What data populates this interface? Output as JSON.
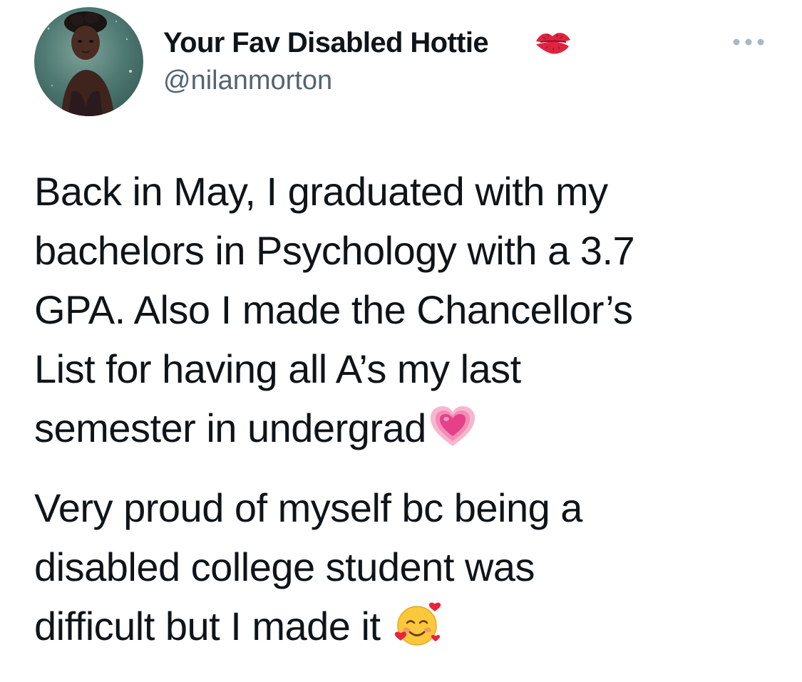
{
  "author": {
    "display_name": "Your Fav Disabled Hottie",
    "name_emoji": "kiss-mark-icon",
    "handle": "@nilanmorton"
  },
  "tweet": {
    "paragraph_1": "Back in May, I graduated with my\nbachelors in Psychology with a 3.7\nGPA. Also I made the Chancellor’s\nList for having all A’s my last\nsemester in undergrad",
    "paragraph_1_emoji": "growing-heart-icon",
    "paragraph_2": "Very proud of myself bc being a\ndisabled college student was\ndifficult but I made it ",
    "paragraph_2_emoji": "smiling-face-with-hearts-icon"
  },
  "colors": {
    "text": "#0f1419",
    "secondary_text": "#536471",
    "background": "#ffffff"
  },
  "icons": {
    "more_menu": "more-horizontal-icon"
  }
}
